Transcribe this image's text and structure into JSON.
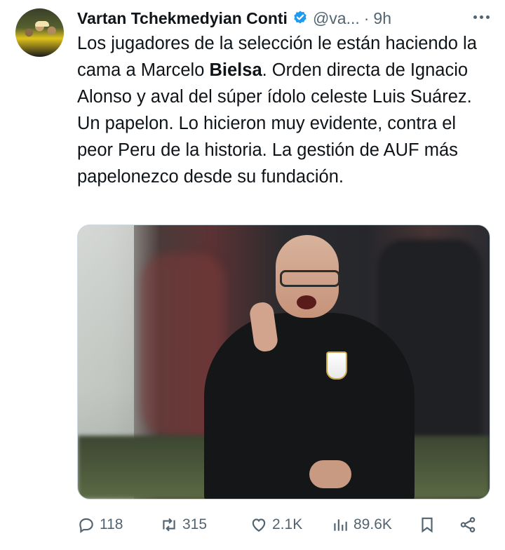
{
  "author": {
    "name": "Vartan Tchekmedyian Conti",
    "handle": "@va...",
    "time": "9h",
    "separator": "·"
  },
  "tweet": {
    "text_before": "Los jugadores de la selección le están haciendo la cama a Marcelo ",
    "text_bold": "Bielsa",
    "text_after": ". Orden directa de Ignacio Alonso y aval del súper ídolo celeste Luis Suárez. Un papelon. Lo hicieron muy evidente, contra el peor Peru de la historia. La gestión de AUF más papelonezco desde su fundación."
  },
  "actions": {
    "replies": "118",
    "retweets": "315",
    "likes": "2.1K",
    "views": "89.6K"
  },
  "colors": {
    "text": "#0f1419",
    "secondary": "#536471",
    "verified": "#1d9bf0"
  }
}
